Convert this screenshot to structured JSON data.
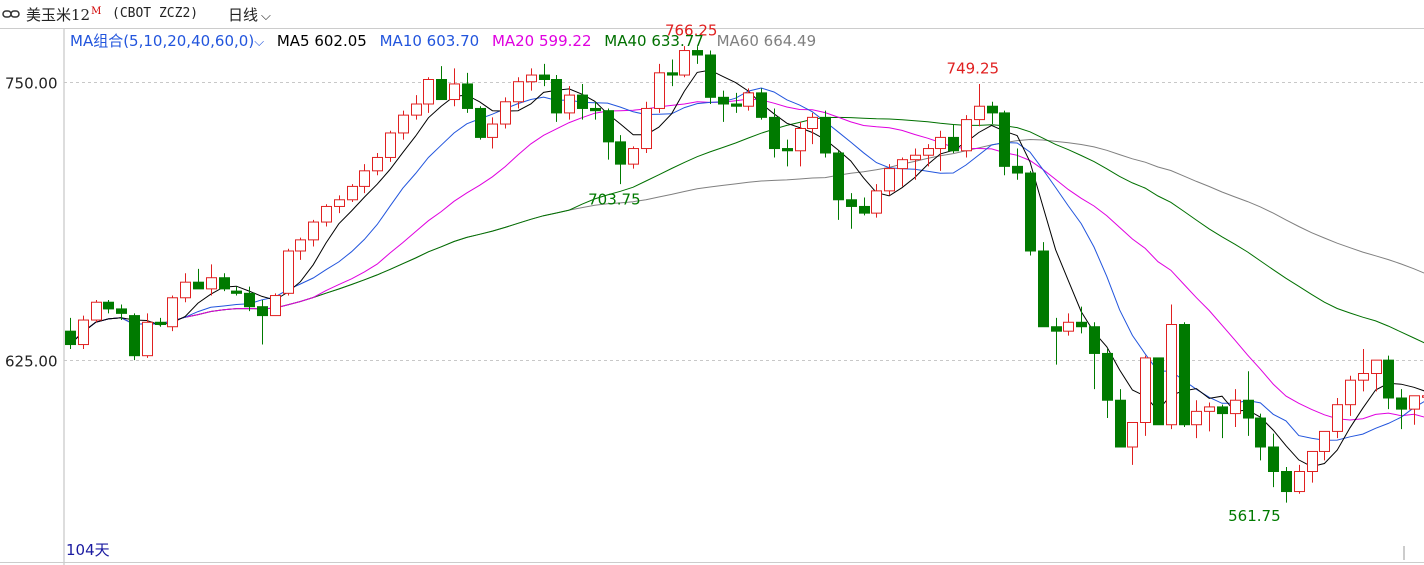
{
  "header": {
    "instrument_name": "美玉米12",
    "instrument_sup": "M",
    "instrument_code": "(CBOT ZCZ2)",
    "period_label": "日线",
    "period_caret": "⌵"
  },
  "ma_legend": {
    "group_label": "MA组合(5,10,20,40,60,0)",
    "group_caret": "⌵",
    "items": [
      {
        "label": "MA5 602.05",
        "color": "#000000"
      },
      {
        "label": "MA10 603.70",
        "color": "#2255dd"
      },
      {
        "label": "MA20 599.22",
        "color": "#e000e0"
      },
      {
        "label": "MA40 633.77",
        "color": "#007000"
      },
      {
        "label": "MA60 664.49",
        "color": "#808080"
      }
    ]
  },
  "footer": {
    "days_label": "104天"
  },
  "colors": {
    "up": "#e02020",
    "down": "#007a00",
    "grid": "#c8c8c8",
    "ma5": "#000000",
    "ma10": "#2255dd",
    "ma20": "#e000e0",
    "ma40": "#007000",
    "ma60": "#808080"
  },
  "chart_data": {
    "type": "candlestick",
    "title": "",
    "ylim": [
      542,
      762
    ],
    "yticks": [
      625,
      750
    ],
    "ytick_labels": [
      "625.00",
      "750.00"
    ],
    "annotations": [
      {
        "text": "766.25",
        "index": 49,
        "value": 766.25,
        "color": "#e02020"
      },
      {
        "text": "703.75",
        "index": 43,
        "value": 703.75,
        "color": "#007a00"
      },
      {
        "text": "749.25",
        "index": 71,
        "value": 749.25,
        "color": "#e02020"
      },
      {
        "text": "561.75",
        "index": 93,
        "value": 561.75,
        "color": "#007a00"
      }
    ],
    "candles": [
      [
        638,
        644,
        630,
        632
      ],
      [
        632,
        645,
        630,
        643
      ],
      [
        643,
        652,
        642,
        651
      ],
      [
        651,
        652,
        646,
        648
      ],
      [
        648,
        650,
        643,
        646
      ],
      [
        645,
        646,
        625,
        627
      ],
      [
        627,
        646,
        626,
        642
      ],
      [
        642,
        644,
        640,
        641
      ],
      [
        640,
        654,
        638,
        653
      ],
      [
        653,
        664,
        651,
        660
      ],
      [
        660,
        666,
        658,
        657
      ],
      [
        657,
        668,
        654,
        662
      ],
      [
        662,
        664,
        656,
        657
      ],
      [
        656,
        658,
        654,
        655
      ],
      [
        655,
        658,
        647,
        649
      ],
      [
        649,
        652,
        632,
        645
      ],
      [
        645,
        655,
        645,
        654
      ],
      [
        655,
        675,
        654,
        674
      ],
      [
        674,
        680,
        670,
        679
      ],
      [
        679,
        688,
        676,
        687
      ],
      [
        687,
        695,
        685,
        694
      ],
      [
        694,
        699,
        691,
        697
      ],
      [
        697,
        704,
        696,
        703
      ],
      [
        703,
        713,
        700,
        710
      ],
      [
        710,
        718,
        708,
        716
      ],
      [
        716,
        728,
        714,
        727
      ],
      [
        727,
        737,
        724,
        735
      ],
      [
        735,
        744,
        733,
        740
      ],
      [
        740,
        752,
        736,
        751
      ],
      [
        751,
        757,
        744,
        742
      ],
      [
        742,
        756,
        739,
        749
      ],
      [
        749,
        754,
        736,
        738
      ],
      [
        738,
        739,
        724,
        725
      ],
      [
        725,
        734,
        720,
        731
      ],
      [
        731,
        743,
        729,
        741
      ],
      [
        741,
        752,
        738,
        750
      ],
      [
        750,
        756,
        746,
        753
      ],
      [
        753,
        758,
        748,
        751
      ],
      [
        751,
        753,
        732,
        736
      ],
      [
        736,
        748,
        733,
        744
      ],
      [
        744,
        749,
        733,
        738
      ],
      [
        738,
        741,
        733,
        737
      ],
      [
        737,
        738,
        715,
        723
      ],
      [
        723,
        726,
        704,
        713
      ],
      [
        713,
        721,
        711,
        720
      ],
      [
        720,
        741,
        718,
        738
      ],
      [
        738,
        758,
        736,
        754
      ],
      [
        754,
        760,
        748,
        753
      ],
      [
        753,
        766,
        752,
        764
      ],
      [
        764,
        766,
        758,
        762
      ],
      [
        762,
        764,
        740,
        743
      ],
      [
        743,
        746,
        732,
        740
      ],
      [
        740,
        745,
        736,
        739
      ],
      [
        739,
        747,
        737,
        745
      ],
      [
        745,
        747,
        733,
        734
      ],
      [
        734,
        738,
        716,
        720
      ],
      [
        720,
        724,
        712,
        719
      ],
      [
        719,
        732,
        712,
        729
      ],
      [
        729,
        736,
        722,
        734
      ],
      [
        734,
        737,
        716,
        718
      ],
      [
        718,
        719,
        688,
        697
      ],
      [
        697,
        700,
        684,
        694
      ],
      [
        694,
        698,
        690,
        691
      ],
      [
        691,
        704,
        689,
        701
      ],
      [
        701,
        713,
        699,
        711
      ],
      [
        711,
        716,
        703,
        715
      ],
      [
        715,
        720,
        706,
        717
      ],
      [
        717,
        722,
        712,
        720
      ],
      [
        720,
        728,
        710,
        725
      ],
      [
        725,
        731,
        718,
        719
      ],
      [
        719,
        735,
        716,
        733
      ],
      [
        733,
        749,
        730,
        739
      ],
      [
        739,
        741,
        731,
        736
      ],
      [
        736,
        737,
        708,
        712
      ],
      [
        712,
        720,
        706,
        709
      ],
      [
        709,
        710,
        672,
        674
      ],
      [
        674,
        678,
        640,
        640
      ],
      [
        640,
        644,
        623,
        638
      ],
      [
        638,
        646,
        636,
        642
      ],
      [
        642,
        649,
        637,
        640
      ],
      [
        640,
        642,
        612,
        628
      ],
      [
        628,
        630,
        599,
        607
      ],
      [
        607,
        612,
        586,
        586
      ],
      [
        586,
        592,
        578,
        597
      ],
      [
        597,
        627,
        591,
        626
      ],
      [
        626,
        626,
        596,
        596
      ],
      [
        596,
        650,
        594,
        641
      ],
      [
        641,
        642,
        595,
        596
      ],
      [
        596,
        607,
        590,
        602
      ],
      [
        602,
        606,
        593,
        604
      ],
      [
        604,
        605,
        590,
        601
      ],
      [
        601,
        612,
        595,
        607
      ],
      [
        607,
        620,
        591,
        599
      ],
      [
        599,
        601,
        580,
        586
      ],
      [
        586,
        592,
        568,
        575
      ],
      [
        575,
        577,
        561,
        566
      ],
      [
        566,
        578,
        565,
        575
      ],
      [
        575,
        584,
        570,
        584
      ],
      [
        584,
        592,
        580,
        593
      ],
      [
        593,
        608,
        590,
        605
      ],
      [
        605,
        618,
        600,
        616
      ],
      [
        616,
        630,
        611,
        619
      ],
      [
        619,
        623,
        611,
        625
      ],
      [
        625,
        627,
        603,
        608
      ],
      [
        608,
        612,
        594,
        603
      ],
      [
        603,
        609,
        596,
        609
      ],
      [
        609,
        613,
        605,
        609
      ],
      [
        609,
        615,
        605,
        608
      ]
    ],
    "ma_last": {
      "MA5": 602.05,
      "MA10": 603.7,
      "MA20": 599.22,
      "MA40": 633.77,
      "MA60": 664.49
    }
  }
}
